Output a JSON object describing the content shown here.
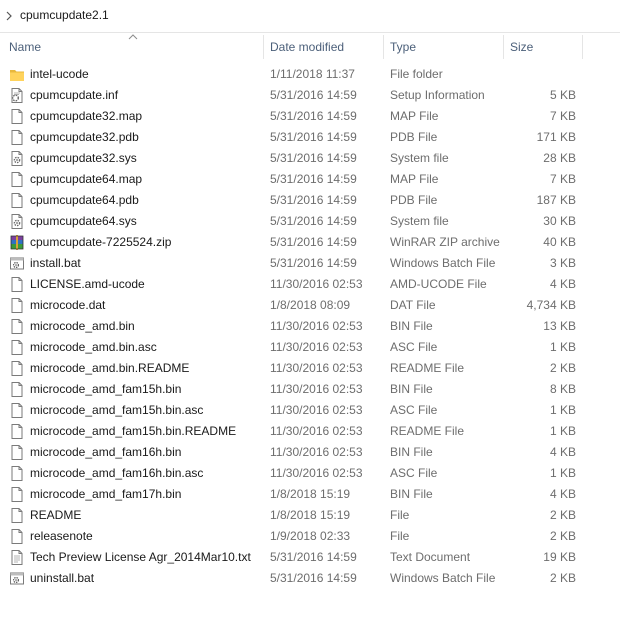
{
  "breadcrumb": {
    "current": "cpumcupdate2.1"
  },
  "columns": {
    "name": "Name",
    "date": "Date modified",
    "type": "Type",
    "size": "Size"
  },
  "files": [
    {
      "name": "intel-ucode",
      "date": "1/11/2018 11:37",
      "type": "File folder",
      "size": "",
      "icon": "folder-icon"
    },
    {
      "name": "cpumcupdate.inf",
      "date": "5/31/2016 14:59",
      "type": "Setup Information",
      "size": "5 KB",
      "icon": "setup-file-icon"
    },
    {
      "name": "cpumcupdate32.map",
      "date": "5/31/2016 14:59",
      "type": "MAP File",
      "size": "7 KB",
      "icon": "document-icon"
    },
    {
      "name": "cpumcupdate32.pdb",
      "date": "5/31/2016 14:59",
      "type": "PDB File",
      "size": "171 KB",
      "icon": "document-icon"
    },
    {
      "name": "cpumcupdate32.sys",
      "date": "5/31/2016 14:59",
      "type": "System file",
      "size": "28 KB",
      "icon": "system-file-icon"
    },
    {
      "name": "cpumcupdate64.map",
      "date": "5/31/2016 14:59",
      "type": "MAP File",
      "size": "7 KB",
      "icon": "document-icon"
    },
    {
      "name": "cpumcupdate64.pdb",
      "date": "5/31/2016 14:59",
      "type": "PDB File",
      "size": "187 KB",
      "icon": "document-icon"
    },
    {
      "name": "cpumcupdate64.sys",
      "date": "5/31/2016 14:59",
      "type": "System file",
      "size": "30 KB",
      "icon": "system-file-icon"
    },
    {
      "name": "cpumcupdate-7225524.zip",
      "date": "5/31/2016 14:59",
      "type": "WinRAR ZIP archive",
      "size": "40 KB",
      "icon": "winrar-archive-icon"
    },
    {
      "name": "install.bat",
      "date": "5/31/2016 14:59",
      "type": "Windows Batch File",
      "size": "3 KB",
      "icon": "batch-file-icon"
    },
    {
      "name": "LICENSE.amd-ucode",
      "date": "11/30/2016 02:53",
      "type": "AMD-UCODE File",
      "size": "4 KB",
      "icon": "document-icon"
    },
    {
      "name": "microcode.dat",
      "date": "1/8/2018 08:09",
      "type": "DAT File",
      "size": "4,734 KB",
      "icon": "document-icon"
    },
    {
      "name": "microcode_amd.bin",
      "date": "11/30/2016 02:53",
      "type": "BIN File",
      "size": "13 KB",
      "icon": "document-icon"
    },
    {
      "name": "microcode_amd.bin.asc",
      "date": "11/30/2016 02:53",
      "type": "ASC File",
      "size": "1 KB",
      "icon": "document-icon"
    },
    {
      "name": "microcode_amd.bin.README",
      "date": "11/30/2016 02:53",
      "type": "README File",
      "size": "2 KB",
      "icon": "document-icon"
    },
    {
      "name": "microcode_amd_fam15h.bin",
      "date": "11/30/2016 02:53",
      "type": "BIN File",
      "size": "8 KB",
      "icon": "document-icon"
    },
    {
      "name": "microcode_amd_fam15h.bin.asc",
      "date": "11/30/2016 02:53",
      "type": "ASC File",
      "size": "1 KB",
      "icon": "document-icon"
    },
    {
      "name": "microcode_amd_fam15h.bin.README",
      "date": "11/30/2016 02:53",
      "type": "README File",
      "size": "1 KB",
      "icon": "document-icon"
    },
    {
      "name": "microcode_amd_fam16h.bin",
      "date": "11/30/2016 02:53",
      "type": "BIN File",
      "size": "4 KB",
      "icon": "document-icon"
    },
    {
      "name": "microcode_amd_fam16h.bin.asc",
      "date": "11/30/2016 02:53",
      "type": "ASC File",
      "size": "1 KB",
      "icon": "document-icon"
    },
    {
      "name": "microcode_amd_fam17h.bin",
      "date": "1/8/2018 15:19",
      "type": "BIN File",
      "size": "4 KB",
      "icon": "document-icon"
    },
    {
      "name": "README",
      "date": "1/8/2018 15:19",
      "type": "File",
      "size": "2 KB",
      "icon": "document-icon"
    },
    {
      "name": "releasenote",
      "date": "1/9/2018 02:33",
      "type": "File",
      "size": "2 KB",
      "icon": "document-icon"
    },
    {
      "name": "Tech Preview License Agr_2014Mar10.txt",
      "date": "5/31/2016 14:59",
      "type": "Text Document",
      "size": "19 KB",
      "icon": "text-document-icon"
    },
    {
      "name": "uninstall.bat",
      "date": "5/31/2016 14:59",
      "type": "Windows Batch File",
      "size": "2 KB",
      "icon": "batch-file-icon"
    }
  ],
  "colors": {
    "header_text": "#4c607a",
    "secondary_text": "#6d6d6d",
    "folder": "#ffd35c"
  }
}
